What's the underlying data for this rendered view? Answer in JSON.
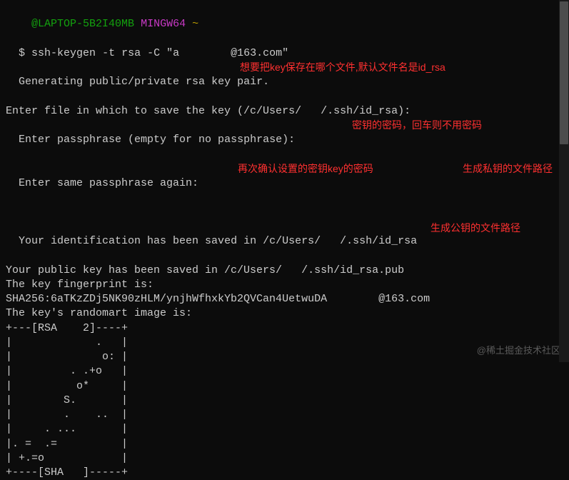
{
  "prompt": {
    "user_host": "  @LAPTOP-5B2I40MB",
    "env": "MINGW64",
    "path": "~",
    "symbol": "$"
  },
  "command": "ssh-keygen -t rsa -C \"a        @163.com\"",
  "output": {
    "line1_a": "Generating public/private rsa ",
    "line1_b": "key pair.",
    "line2": "Enter file in which to save the key (/c/Users/   /.ssh/id_rsa):",
    "line3": "Enter passphrase (empty for no passphrase):",
    "line4": "Enter same passphrase again:",
    "line5": "Your identification has been saved in /c/Users/   /.ssh/id_rsa",
    "line6": "Your public key has been saved in /c/Users/   /.ssh/id_rsa.pub",
    "line7": "The key fingerprint is:",
    "line8": "SHA256:6aTKzZDj5NK90zHLM/ynjhWfhxkYb2QVCan4UetwuDA        @163.com",
    "line9": "The key's randomart image is:"
  },
  "randomart": [
    "+---[RSA    2]----+",
    "|             .   |",
    "|              o: |",
    "|         . .+o   |",
    "|          o*     |",
    "|        S.       |",
    "|        .    ..  |",
    "|     . ...       |",
    "|. =  .=          |",
    "| +.=o            |",
    "+----[SHA   ]-----+"
  ],
  "annotations": {
    "a1": "想要把key保存在哪个文件,默认文件名是id_rsa",
    "a2": "密钥的密码，回车则不用密码",
    "a3": "再次确认设置的密钥key的密码",
    "a4": "生成私钥的文件路径",
    "a5": "生成公钥的文件路径"
  },
  "watermark": "@稀土掘金技术社区"
}
